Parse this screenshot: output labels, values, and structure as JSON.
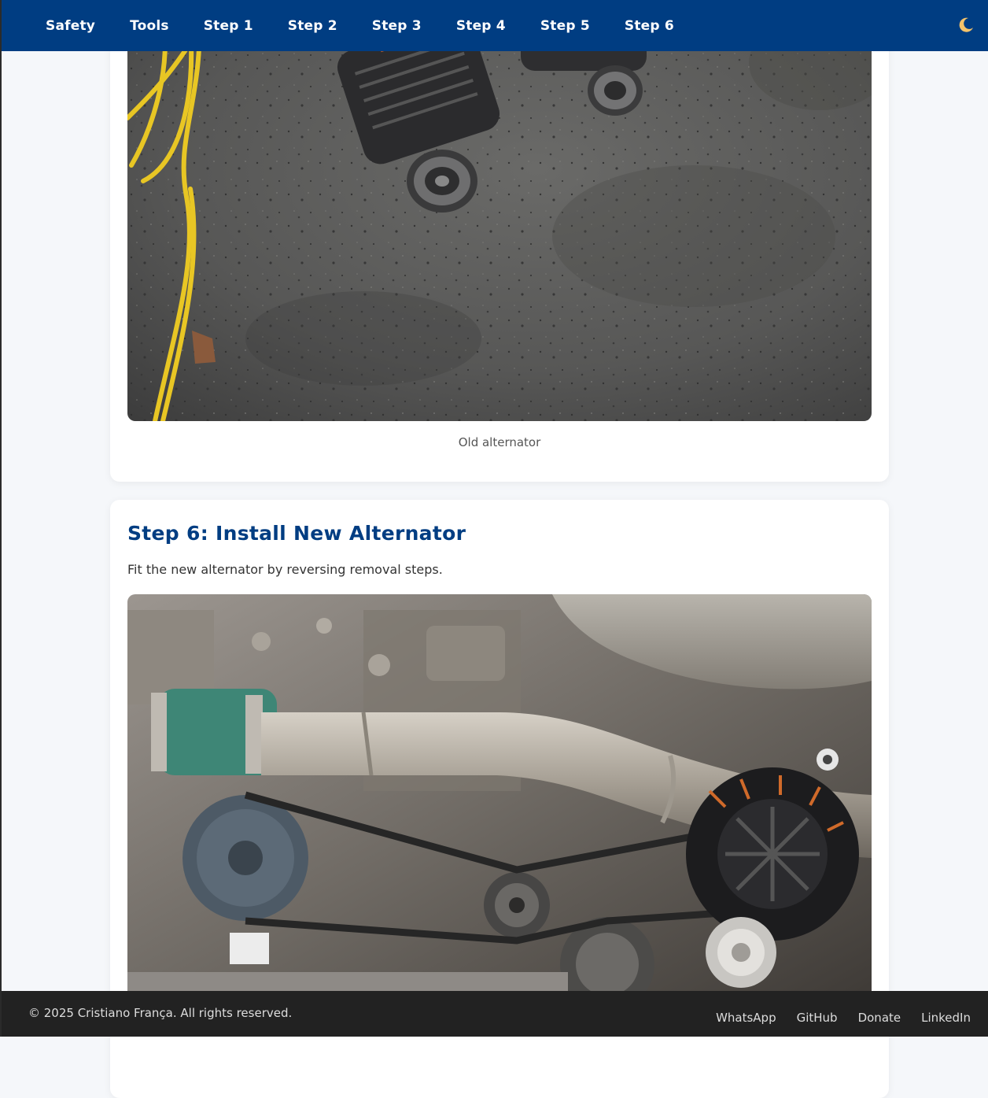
{
  "nav": {
    "links": [
      "Safety",
      "Tools",
      "Step 1",
      "Step 2",
      "Step 3",
      "Step 4",
      "Step 5",
      "Step 6"
    ],
    "theme_toggle_icon": "moon-icon"
  },
  "sections": {
    "previous": {
      "image_caption": "Old alternator"
    },
    "step6": {
      "title": "Step 6: Install New Alternator",
      "description": "Fit the new alternator by reversing removal steps."
    }
  },
  "footer": {
    "copyright": "© 2025 Cristiano França. All rights reserved.",
    "links": [
      "WhatsApp",
      "GitHub",
      "Donate",
      "LinkedIn"
    ]
  },
  "colors": {
    "nav_background": "#003d82",
    "heading": "#003d82",
    "footer_background": "#222222",
    "page_background": "#f5f7fa"
  }
}
